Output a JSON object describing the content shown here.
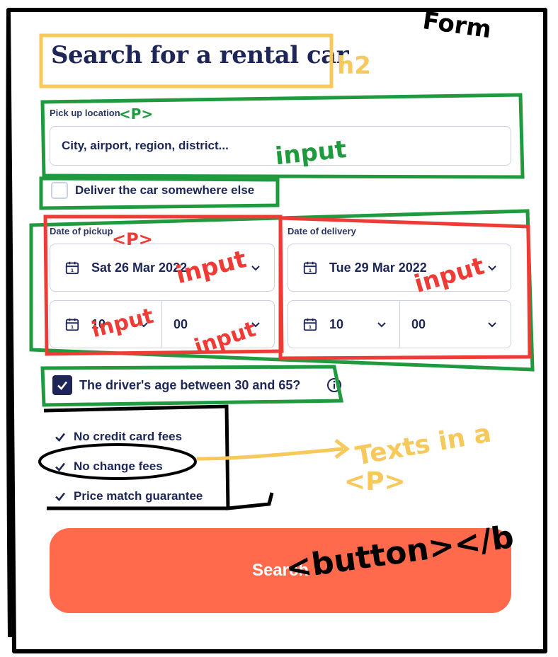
{
  "form": {
    "title": "Search for a rental car",
    "pickup_label": "Pick up location",
    "pickup_placeholder": "City, airport, region, district...",
    "deliver_label": "Deliver the car somewhere else",
    "date_pickup_label": "Date of pickup",
    "date_pickup_value": "Sat 26 Mar 2022",
    "pickup_hour": "10",
    "pickup_minute": "00",
    "date_delivery_label": "Date of delivery",
    "date_delivery_value": "Tue 29 Mar 2022",
    "delivery_hour": "10",
    "delivery_minute": "00",
    "age_label": "The driver's age between 30 and 65?",
    "age_checked": true,
    "features": [
      "No credit card fees",
      "No change fees",
      "Price match guarantee"
    ],
    "search_label": "Search"
  },
  "annotations": {
    "form": "Form",
    "h2": "h2",
    "p_pickup": "<P>",
    "input_pickup": "input",
    "p_date": "<P>",
    "input_date_pickup": "input",
    "input_hour": "input",
    "input_minute": "input",
    "input_date_delivery": "input",
    "texts_note_1": "Texts in a",
    "texts_note_2": "<P>",
    "button_note": "<button></b"
  },
  "colors": {
    "brand_navy": "#1d2657",
    "search_button": "#ff6a4d",
    "annotation_yellow": "#f7c85c",
    "annotation_green": "#1f9a3e",
    "annotation_red": "#ee3b36",
    "annotation_black": "#000000"
  }
}
